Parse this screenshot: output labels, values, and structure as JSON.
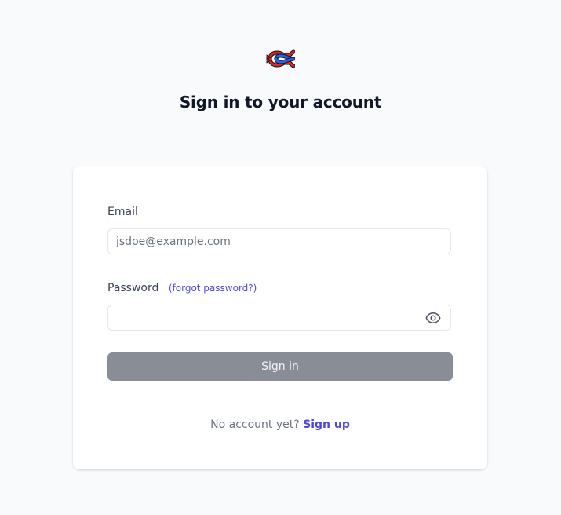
{
  "header": {
    "logo_icon": "knot-logo-icon",
    "title": "Sign in to your account"
  },
  "form": {
    "email": {
      "label": "Email",
      "value": "",
      "placeholder": "jsdoe@example.com"
    },
    "password": {
      "label": "Password",
      "forgot_link": "(forgot password?)",
      "value": "",
      "placeholder": "",
      "toggle_icon": "eye-icon"
    },
    "submit_label": "Sign in"
  },
  "footer": {
    "prompt": "No account yet?",
    "signup_link": "Sign up"
  },
  "colors": {
    "background": "#f8fafc",
    "accent": "#4f46e5",
    "button_disabled": "#898d96",
    "logo_red": "#dc2626",
    "logo_blue": "#2563eb"
  }
}
